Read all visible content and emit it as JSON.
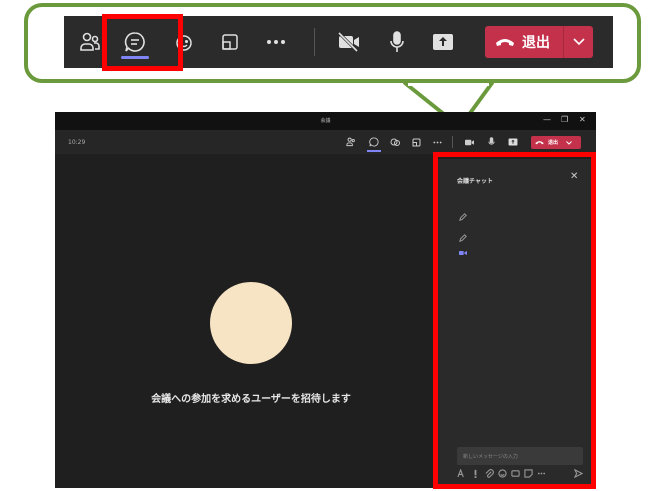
{
  "zoom_toolbar": {
    "items": [
      {
        "name": "people-icon",
        "label": "people"
      },
      {
        "name": "chat-icon",
        "label": "chat",
        "active": true
      },
      {
        "name": "reactions-icon",
        "label": "reactions"
      },
      {
        "name": "share-tray-icon",
        "label": "view"
      },
      {
        "name": "more-icon",
        "label": "more"
      },
      {
        "name": "camera-off-icon",
        "label": "camera off"
      },
      {
        "name": "microphone-icon",
        "label": "microphone"
      },
      {
        "name": "share-screen-icon",
        "label": "share"
      }
    ],
    "leave_label": "退出"
  },
  "window": {
    "title": "会議",
    "time": "10:29",
    "leave_label": "退出",
    "controls": [
      "—",
      "❐",
      "✕"
    ]
  },
  "stage": {
    "invite_text": "会議への参加を求めるユーザーを招待します"
  },
  "chat": {
    "title": "会議チャット",
    "close": "✕",
    "input_placeholder": "新しいメッセージの入力"
  },
  "colors": {
    "accent": "#7f85f5",
    "leave": "#c4314b",
    "highlight": "#ff0000",
    "callout": "#6a9a3c",
    "avatar": "#f6e4c4"
  }
}
